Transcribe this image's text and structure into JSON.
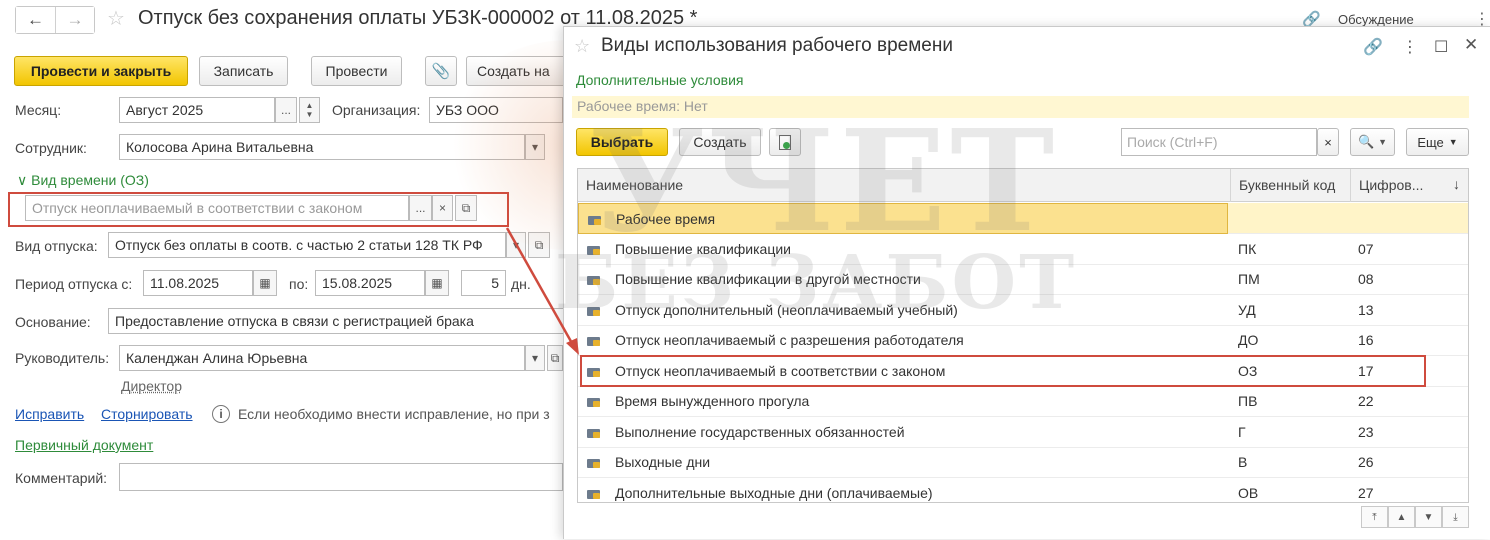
{
  "main": {
    "title": "Отпуск без сохранения оплаты УБЗК-000002 от 11.08.2025 *",
    "discussion": "Обсуждение",
    "toolbar": {
      "post_close": "Провести и закрыть",
      "save": "Записать",
      "post": "Провести",
      "create_based": "Создать на"
    },
    "month_label": "Месяц:",
    "month_value": "Август 2025",
    "org_label": "Организация:",
    "org_value": "УБЗ ООО",
    "employee_label": "Сотрудник:",
    "employee_value": "Колосова Арина Витальевна",
    "time_type_group": "Вид времени (ОЗ)",
    "time_type_value": "Отпуск неоплачиваемый в соответствии с законом",
    "leave_type_label": "Вид отпуска:",
    "leave_type_value": "Отпуск без оплаты в соотв. с частью 2 статьи 128 ТК РФ",
    "period_label": "Период отпуска с:",
    "period_from": "11.08.2025",
    "period_to_label": "по:",
    "period_to": "15.08.2025",
    "days_value": "5",
    "days_unit": "дн.",
    "basis_label": "Основание:",
    "basis_value": "Предоставление отпуска в связи с регистрацией брака",
    "manager_label": "Руководитель:",
    "manager_value": "Календжан Алина Юрьевна",
    "manager_position": "Директор",
    "fix_link": "Исправить",
    "storno_link": "Сторнировать",
    "info_text": "Если необходимо внести исправление, но при з",
    "primary_doc_link": "Первичный документ",
    "comment_label": "Комментарий:"
  },
  "dialog": {
    "title": "Виды использования рабочего времени",
    "conditions_link": "Дополнительные условия",
    "conditions_filter": "Рабочее время: Нет",
    "select_btn": "Выбрать",
    "create_btn": "Создать",
    "search_placeholder": "Поиск (Ctrl+F)",
    "more_btn": "Еще",
    "columns": [
      "Наименование",
      "Буквенный код",
      "Цифров..."
    ],
    "rows": [
      {
        "name": "Рабочее время",
        "code": "",
        "num": ""
      },
      {
        "name": "Повышение квалификации",
        "code": "ПК",
        "num": "07"
      },
      {
        "name": "Повышение квалификации в другой местности",
        "code": "ПМ",
        "num": "08"
      },
      {
        "name": "Отпуск дополнительный (неоплачиваемый учебный)",
        "code": "УД",
        "num": "13"
      },
      {
        "name": "Отпуск неоплачиваемый с разрешения работодателя",
        "code": "ДО",
        "num": "16"
      },
      {
        "name": "Отпуск неоплачиваемый в соответствии с законом",
        "code": "ОЗ",
        "num": "17"
      },
      {
        "name": "Время вынужденного прогула",
        "code": "ПВ",
        "num": "22"
      },
      {
        "name": "Выполнение государственных обязанностей",
        "code": "Г",
        "num": "23"
      },
      {
        "name": "Выходные дни",
        "code": "В",
        "num": "26"
      },
      {
        "name": "Дополнительные выходные дни (оплачиваемые)",
        "code": "ОВ",
        "num": "27"
      }
    ]
  },
  "watermark": {
    "line1": "УЧЕТ",
    "line2": "БЕЗ ЗАБОТ"
  },
  "colors": {
    "accent_yellow": "#f2c500",
    "highlight_red": "#cf4b3e",
    "link_green": "#2e8b3a",
    "link_blue": "#1a55b5"
  }
}
